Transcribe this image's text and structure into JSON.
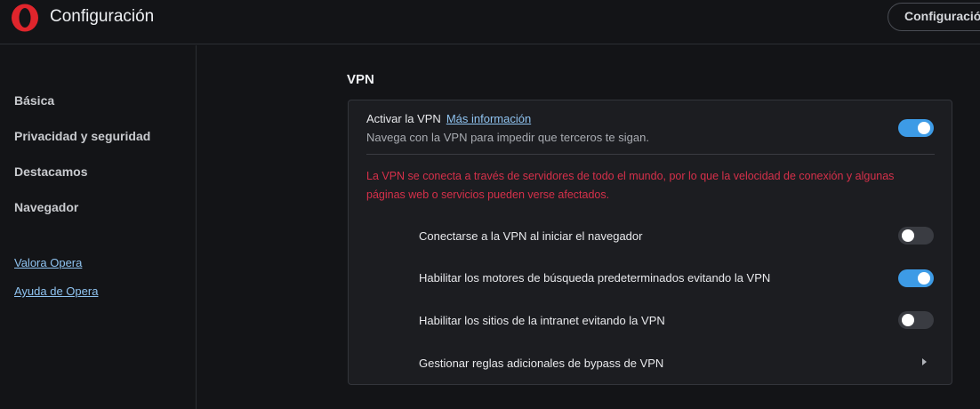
{
  "header": {
    "title": "Configuración",
    "search_placeholder": "Configuración",
    "logo_icon": "opera-logo-icon",
    "logo_color": "#e0252c"
  },
  "sidebar": {
    "items": [
      {
        "label": "Básica"
      },
      {
        "label": "Privacidad y seguridad"
      },
      {
        "label": "Destacamos"
      },
      {
        "label": "Navegador"
      }
    ],
    "links": [
      {
        "label": "Valora Opera"
      },
      {
        "label": "Ayuda de Opera"
      }
    ]
  },
  "vpn": {
    "section_title": "VPN",
    "activate_label": "Activar la VPN",
    "more_info_link": "Más información",
    "description": "Navega con la VPN para impedir que terceros te sigan.",
    "enabled": true,
    "warning": "La VPN se conecta a través de servidores de todo el mundo, por lo que la velocidad de conexión y algunas páginas web o servicios pueden verse afectados.",
    "options": [
      {
        "label": "Conectarse a la VPN al iniciar el navegador",
        "enabled": false
      },
      {
        "label": "Habilitar los motores de búsqueda predeterminados evitando la VPN",
        "enabled": true
      },
      {
        "label": "Habilitar los sitios de la intranet evitando la VPN",
        "enabled": false
      }
    ],
    "bypass_rules_label": "Gestionar reglas adicionales de bypass de VPN",
    "accent_color": "#3d9be6",
    "warning_color": "#d6304a"
  }
}
